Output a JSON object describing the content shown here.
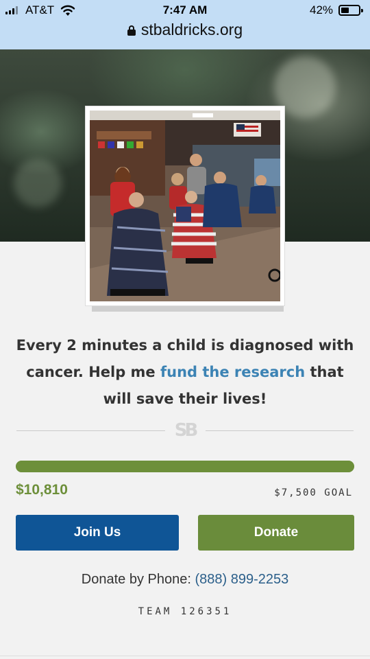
{
  "status_bar": {
    "carrier": "AT&T",
    "time": "7:47 AM",
    "battery_percent": "42%",
    "battery_level": 0.42,
    "icons": [
      "signal-icon",
      "wifi-icon",
      "battery-icon"
    ]
  },
  "browser": {
    "url": "stbaldricks.org",
    "icon": "lock-icon"
  },
  "hero": {
    "photo_alt": "Group of people in a barber shop with capes on barber chairs"
  },
  "message": {
    "before": "Every 2 minutes a child is diagnosed with cancer. Help me ",
    "link": "fund the research",
    "after": " that will save their lives!"
  },
  "divider_logo": "SB",
  "fundraising": {
    "raised": "$10,810",
    "goal": "$7,500 GOAL",
    "progress_fraction": 1.0
  },
  "buttons": {
    "join": "Join Us",
    "donate": "Donate"
  },
  "phone": {
    "label": "Donate by Phone: ",
    "number": "(888) 899-2253"
  },
  "team": "TEAM 126351",
  "colors": {
    "topbar": "#c3ddf5",
    "link": "#3c83b4",
    "green": "#6d8f3a",
    "join_blue": "#0f5596"
  }
}
